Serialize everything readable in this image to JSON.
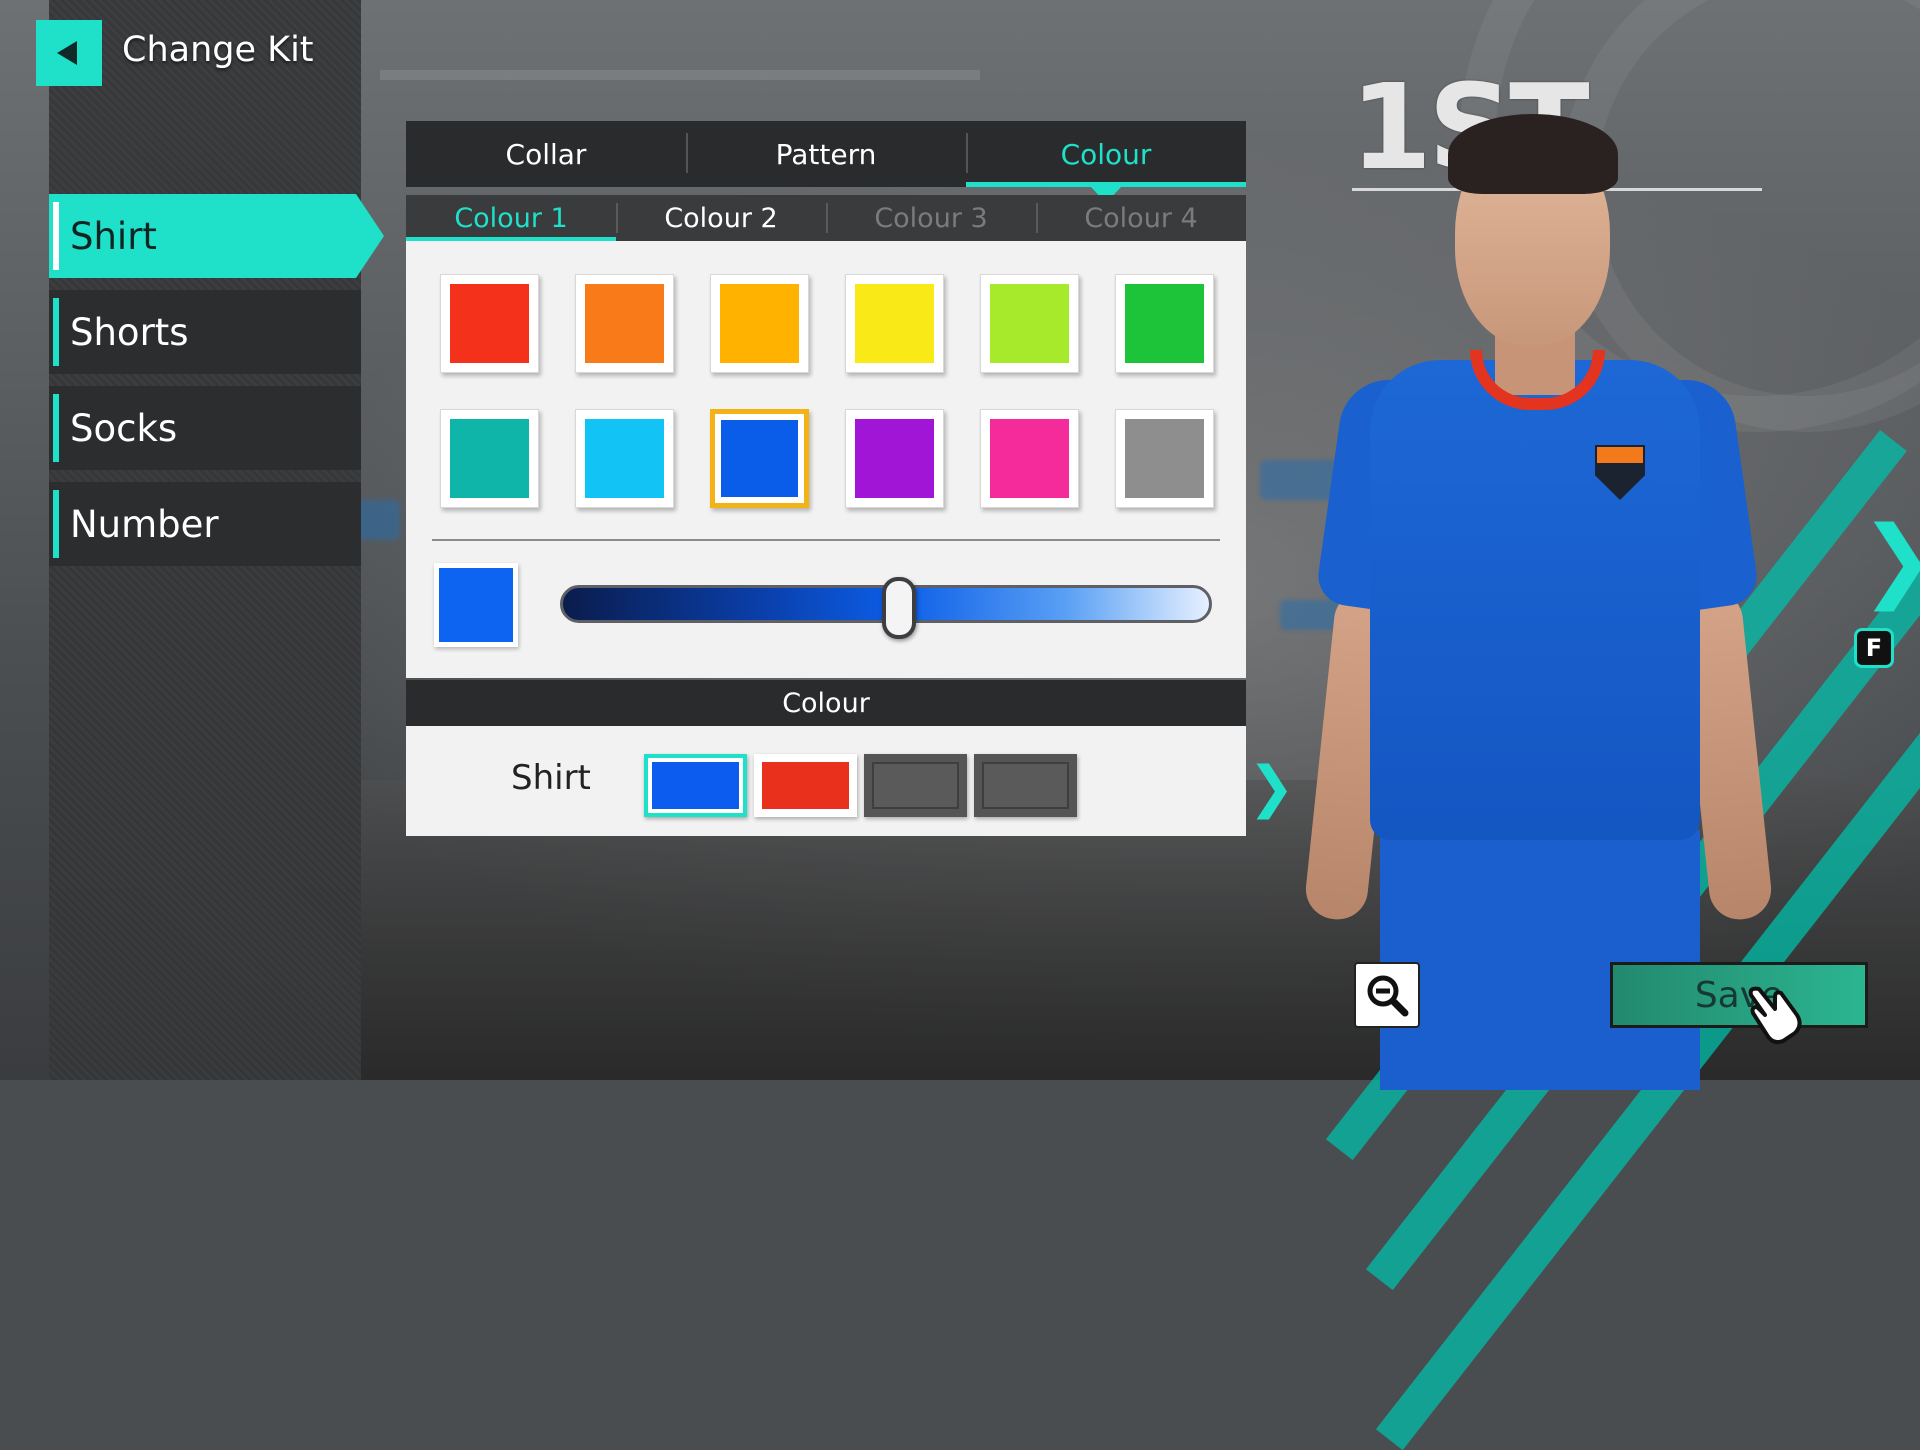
{
  "header": {
    "title": "Change Kit",
    "back_icon": "back-arrow-icon"
  },
  "sidebar": {
    "items": [
      {
        "label": "Shirt",
        "active": true
      },
      {
        "label": "Shorts",
        "active": false
      },
      {
        "label": "Socks",
        "active": false
      },
      {
        "label": "Number",
        "active": false
      }
    ]
  },
  "tabs": {
    "top": [
      {
        "label": "Collar",
        "active": false
      },
      {
        "label": "Pattern",
        "active": false
      },
      {
        "label": "Colour",
        "active": true
      }
    ],
    "sub": [
      {
        "label": "Colour 1",
        "state": "active"
      },
      {
        "label": "Colour 2",
        "state": "normal"
      },
      {
        "label": "Colour 3",
        "state": "disabled"
      },
      {
        "label": "Colour 4",
        "state": "disabled"
      }
    ]
  },
  "palette": {
    "swatches": [
      "#f4311a",
      "#f97a18",
      "#ffb300",
      "#f9ea17",
      "#a7ea2c",
      "#1dc43a",
      "#0fb5a8",
      "#12c4f6",
      "#0a5de8",
      "#a116d6",
      "#f62b9b",
      "#8e8e8e"
    ],
    "selected_index": 8
  },
  "shade": {
    "preview_color": "#0c64f0",
    "slider_value": 0.52
  },
  "info": {
    "header": "Colour",
    "row_label": "Shirt",
    "kit_colours": [
      {
        "color": "#0c5cf0",
        "state": "active"
      },
      {
        "color": "#e8301c",
        "state": "normal"
      },
      {
        "color": "#5a5a5b",
        "state": "empty"
      },
      {
        "color": "#5a5a5b",
        "state": "empty"
      }
    ]
  },
  "kit": {
    "label": "1ST"
  },
  "controls": {
    "next_arrow": "chevron-right-icon",
    "f_key": "F",
    "zoom_icon": "zoom-out-icon",
    "save_label": "Save"
  },
  "colors": {
    "accent": "#1fe0c8",
    "selection": "#f1b316",
    "shirt": "#1a60cf"
  }
}
